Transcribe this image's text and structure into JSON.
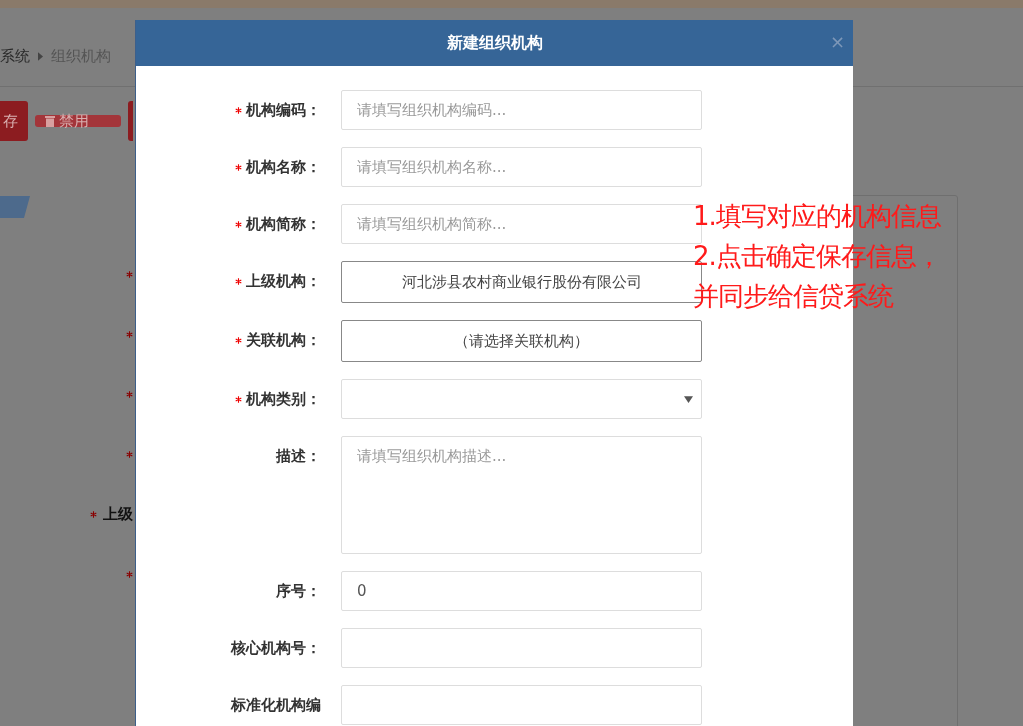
{
  "background": {
    "breadcrumb": [
      {
        "label": "系统"
      },
      {
        "label": "组织机构"
      }
    ],
    "toolbar_buttons": [
      {
        "label": "存",
        "kind": "plain"
      },
      {
        "label": "禁用",
        "kind": "trash"
      }
    ],
    "form_labels": [
      {
        "required": true
      },
      {
        "required": true
      },
      {
        "required": true
      },
      {
        "required": true
      },
      {
        "label": "上级",
        "required": true
      },
      {
        "required": true
      }
    ]
  },
  "dialog": {
    "title": "新建组织机构",
    "close": "×",
    "fields": [
      {
        "label": "机构编码：",
        "required": true,
        "kind": "input",
        "placeholder": "请填写组织机构编码..."
      },
      {
        "label": "机构名称：",
        "required": true,
        "kind": "input",
        "placeholder": "请填写组织机构名称..."
      },
      {
        "label": "机构简称：",
        "required": true,
        "kind": "input",
        "placeholder": "请填写组织机构简称..."
      },
      {
        "label": "上级机构：",
        "required": true,
        "kind": "picker",
        "value": "河北涉县农村商业银行股份有限公司"
      },
      {
        "label": "关联机构：",
        "required": true,
        "kind": "picker",
        "value": "（请选择关联机构）"
      },
      {
        "label": "机构类别：",
        "required": true,
        "kind": "select"
      },
      {
        "label": "描述：",
        "required": false,
        "kind": "textarea",
        "placeholder": "请填写组织机构描述..."
      },
      {
        "label": "序号：",
        "required": false,
        "kind": "input",
        "value": "0"
      },
      {
        "label": "核心机构号：",
        "required": false,
        "kind": "input"
      },
      {
        "label": "标准化机构编",
        "required": false,
        "kind": "input"
      }
    ]
  },
  "annotation": {
    "lines": [
      "1.填写对应的机构信息",
      "2.点击确定保存信息，",
      "并同步给信贷系统"
    ]
  }
}
